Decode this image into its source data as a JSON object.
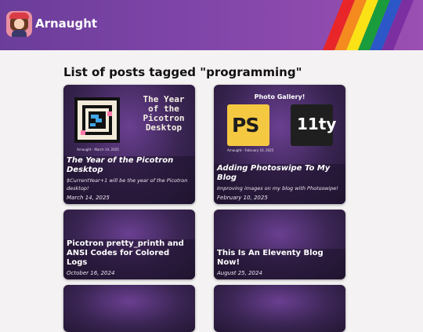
{
  "site": {
    "name": "Arnaught"
  },
  "page": {
    "heading": "List of posts tagged \"programming\""
  },
  "posts": [
    {
      "title": "The Year of the Picotron Desktop",
      "description": "$CurrentYear+1 will be the year of the Picotron desktop!",
      "date": "March 14, 2025",
      "thumbnail_text": "The Year of the Picotron Desktop",
      "thumbnail_credit": "Arnaught - March 14, 2025"
    },
    {
      "title": "Adding Photoswipe To My Blog",
      "description": "Improving images on my blog with Photoswipe!",
      "date": "February 10, 2025",
      "thumbnail_text": "Photo Gallery!",
      "thumbnail_credit": "Arnaught - February 10, 2025",
      "thumbnail_tiles": [
        "PS",
        "11ty"
      ]
    },
    {
      "title": "Picotron pretty_printh and ANSI Codes for Colored Logs",
      "date": "October 16, 2024"
    },
    {
      "title": "This Is An Eleventy Blog Now!",
      "date": "August 25, 2024"
    },
    {},
    {}
  ],
  "colors": {
    "header": "#7f45a8",
    "card": "#3a2553",
    "page_background": "#f4f2f2",
    "rainbow": [
      "#e8262a",
      "#f58a1f",
      "#fbe216",
      "#1a9c3c",
      "#2c57c9",
      "#7b2fa1"
    ]
  },
  "icons": {
    "logo": "avatar-girl-red-hat-icon"
  }
}
